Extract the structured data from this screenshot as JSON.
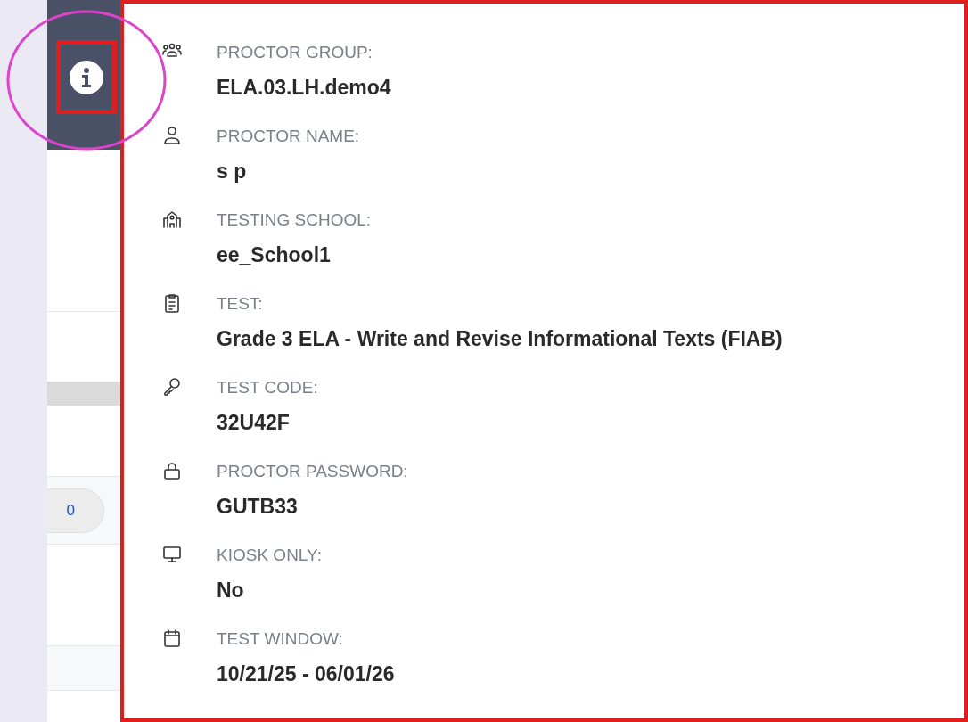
{
  "background": {
    "count_pill": "0"
  },
  "details": [
    {
      "kind": "group",
      "label": "PROCTOR GROUP:",
      "value": "ELA.03.LH.demo4"
    },
    {
      "kind": "person",
      "label": "PROCTOR NAME:",
      "value": "s p"
    },
    {
      "kind": "school",
      "label": "TESTING SCHOOL:",
      "value": "ee_School1"
    },
    {
      "kind": "clipboard",
      "label": "TEST:",
      "value": "Grade 3 ELA - Write and Revise Informational Texts (FIAB)"
    },
    {
      "kind": "key",
      "label": "TEST CODE:",
      "value": "32U42F"
    },
    {
      "kind": "lock",
      "label": "PROCTOR PASSWORD:",
      "value": "GUTB33"
    },
    {
      "kind": "monitor",
      "label": "KIOSK ONLY:",
      "value": "No"
    },
    {
      "kind": "calendar",
      "label": "TEST WINDOW:",
      "value": "10/21/25 - 06/01/26"
    }
  ]
}
